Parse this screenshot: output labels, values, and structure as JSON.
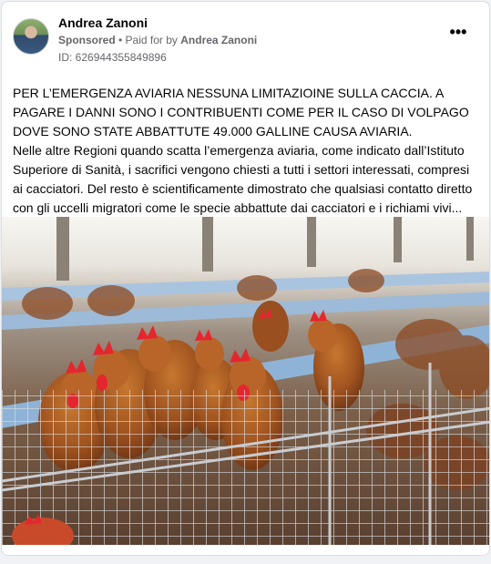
{
  "post": {
    "page_name": "Andrea Zanoni",
    "sponsored_label": "Sponsored",
    "separator": " • ",
    "paid_for_label": "Paid for by ",
    "paid_for_name": "Andrea Zanoni",
    "ad_id": "ID: 626944355849896",
    "more_icon": "more-horizontal-icon",
    "more_glyph": "•••",
    "text_paragraph_1": "PER L’EMERGENZA AVIARIA NESSUNA LIMITAZIOINE SULLA CACCIA. A PAGARE I DANNI SONO I CONTRIBUENTI COME PER IL CASO DI VOLPAGO DOVE SONO STATE ABBATTUTE 49.000 GALLINE CAUSA AVIARIA.",
    "text_paragraph_2": "Nelle altre Regioni quando scatta l’emergenza aviaria, come indicato dall’Istituto Superiore di Sanità, i sacrifici vengono chiesti a tutti i settori interessati, compresi ai cacciatori. Del resto è scientificamente dimostrato che qualsiasi contatto diretto con gli uccelli migratori come le specie abbattute dai cacciatori e i richiami vivi..."
  },
  "colors": {
    "card_background": "#ffffff",
    "page_background": "#f0f2f5",
    "meta_text": "#65676b",
    "hen_feather": "#a0531f",
    "hen_comb": "#e5262e",
    "cage_wire": "#c9ccd1",
    "feed_trough": "#8fb3d6"
  }
}
